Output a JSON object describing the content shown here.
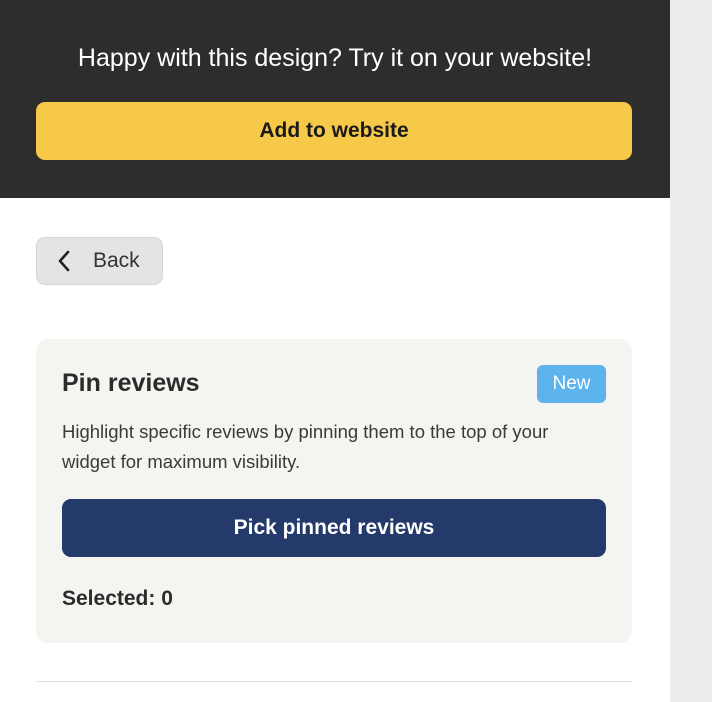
{
  "banner": {
    "text": "Happy with this design? Try it on your website!",
    "add_button_label": "Add to website"
  },
  "back_button": {
    "label": "Back",
    "icon": "chevron-left-icon"
  },
  "pin_reviews": {
    "title": "Pin reviews",
    "badge": "New",
    "description": "Highlight specific reviews by pinning them to the top of your widget for maximum visibility.",
    "pick_button_label": "Pick pinned reviews",
    "selected_text": "Selected: 0"
  },
  "colors": {
    "banner_bg": "#2d2d2d",
    "accent_yellow": "#f7c948",
    "navy_button": "#243a6b",
    "badge_blue": "#5db3ec",
    "card_bg": "#f4f4f1"
  }
}
